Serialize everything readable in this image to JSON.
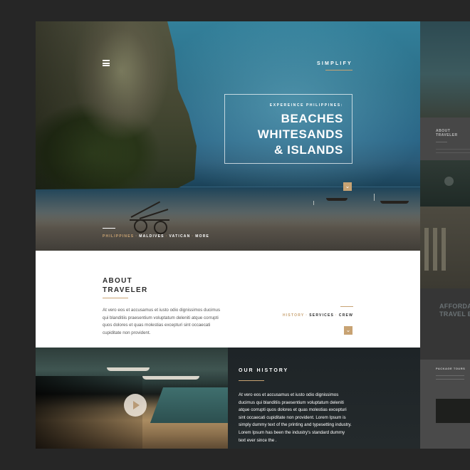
{
  "brand": {
    "logo": "SIMPLIFY"
  },
  "hero": {
    "eyebrow": "EXPEREINCE PHILIPPINES:",
    "headline_lines": [
      "BEACHES",
      "WHITESANDS",
      "& ISLANDS"
    ],
    "destinations": [
      "PHILIPPINES",
      "MALDIVES",
      "VATICAN",
      "MORE"
    ]
  },
  "about": {
    "title_lines": [
      "ABOUT",
      "TRAVELER"
    ],
    "text": "At vero eos et accusamus et iusto odio dignissimos ducimus qui blanditiis praesentium voluptatum deleniti atque corrupti quos dolores et quas molestias excepturi sint occaecati cupiditate non provident.",
    "nav": [
      "HISTORY",
      "SERVICES",
      "CREW"
    ]
  },
  "history": {
    "title": "OUR HISTORY",
    "text": "At vero eos et accusamus et iusto odio dignissimos ducimus qui blanditiis praesentium voluptatum deleniti atque corrupti quos dolores et quas molestias excepturi sint occaecati cupiditate non provident. Lorem Ipsum is simply dummy text of the printing and typesetting industry. Lorem Ipsum has been the industry's standard dummy text ever since the ."
  },
  "side_preview": {
    "about_title_lines": [
      "ABOUT",
      "TRAVELER"
    ],
    "afford_lines": [
      "AFFORDAB",
      "TRAVEL EX"
    ],
    "package_label": "PACKAGE TOURS"
  },
  "icons": {
    "menu": "hamburger-menu-icon",
    "scroll": "chevron-down-icon",
    "play": "play-icon"
  },
  "colors": {
    "accent": "#c8a373",
    "background": "#262626",
    "text_dark": "#2b2b2b"
  }
}
